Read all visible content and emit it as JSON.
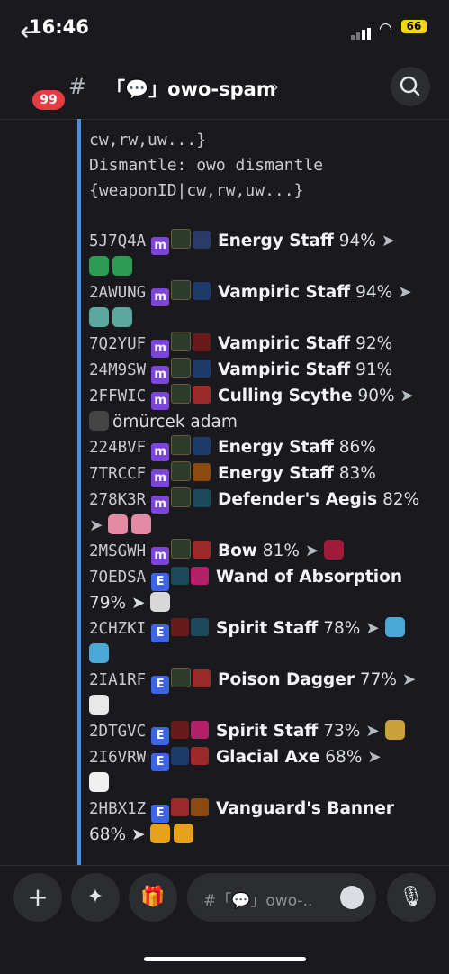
{
  "status": {
    "time": "16:46",
    "battery": "66"
  },
  "header": {
    "badge": "99",
    "hash": "#",
    "channel": "「💬」owo-spam",
    "chevron": "›"
  },
  "message": {
    "top_lines": [
      "cw,rw,uw...}",
      "Dismantle: owo dismantle",
      "{weaponID|cw,rw,uw...}"
    ],
    "rows": [
      {
        "id": "5J7Q4A",
        "q": "m",
        "name": "Energy Staff",
        "pct": "94%",
        "arrow": "➤"
      },
      {
        "id": "2AWUNG",
        "q": "m",
        "name": "Vampiric Staff",
        "pct": "94%",
        "arrow": "➤"
      },
      {
        "id": "7Q2YUF",
        "q": "m",
        "name": "Vampiric Staff",
        "pct": "92%",
        "arrow": ""
      },
      {
        "id": "24M9SW",
        "q": "m",
        "name": "Vampiric Staff",
        "pct": "91%",
        "arrow": ""
      },
      {
        "id": "2FFWIC",
        "q": "m",
        "name": "Culling Scythe",
        "pct": "90%",
        "arrow": "➤"
      },
      {
        "id": "224BVF",
        "q": "m",
        "name": "Energy Staff",
        "pct": "86%",
        "arrow": ""
      },
      {
        "id": "7TRCCF",
        "q": "m",
        "name": "Energy Staff",
        "pct": "83%",
        "arrow": ""
      },
      {
        "id": "278K3R",
        "q": "m",
        "name": "Defender's Aegis",
        "pct": "82%",
        "arrow": ""
      },
      {
        "id": "2MSGWH",
        "q": "m",
        "name": "Bow",
        "pct": "81%",
        "arrow": "➤"
      },
      {
        "id": "7OEDSA",
        "q": "e",
        "name": "Wand of Absorption",
        "pct": "",
        "arrow": ""
      },
      {
        "id": "2CHZKI",
        "q": "e",
        "name": "Spirit Staff",
        "pct": "78%",
        "arrow": "➤"
      },
      {
        "id": "2IA1RF",
        "q": "e",
        "name": "Poison Dagger",
        "pct": "77%",
        "arrow": "➤"
      },
      {
        "id": "2DTGVC",
        "q": "e",
        "name": "Spirit Staff",
        "pct": "73%",
        "arrow": "➤"
      },
      {
        "id": "2I6VRW",
        "q": "e",
        "name": "Glacial Axe",
        "pct": "68%",
        "arrow": "➤"
      },
      {
        "id": "2HBX1Z",
        "q": "e",
        "name": "Vanguard's Banner",
        "pct": "",
        "arrow": ""
      }
    ],
    "wrap": {
      "r1": "",
      "r2": "",
      "r5": "ömürcek adam",
      "r8": "➤",
      "r10": "79% ➤",
      "r15": "68% ➤"
    },
    "quality_m": "m",
    "quality_e": "E"
  },
  "composer": {
    "placeholder": "#「💬」owo-..",
    "plus": "+",
    "mic": "🎙"
  }
}
